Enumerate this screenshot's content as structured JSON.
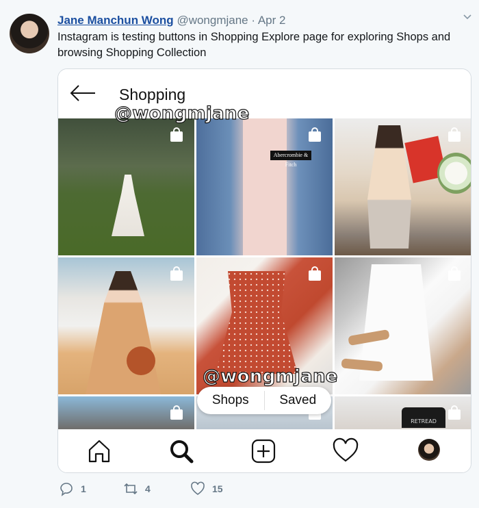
{
  "tweet": {
    "author_name": "Jane Manchun Wong",
    "handle": "@wongmjane",
    "separator": "·",
    "date": "Apr 2",
    "text": "Instagram is testing buttons in Shopping Explore page for exploring Shops and browsing Shopping Collection"
  },
  "screenshot": {
    "title": "Shopping",
    "watermark": "@wongmjane",
    "tiles": [
      {
        "name": "dress-photo"
      },
      {
        "name": "hoodie-photo",
        "label": "Abercrombie & Fitch"
      },
      {
        "name": "flowers-photo"
      },
      {
        "name": "camel-suit-photo"
      },
      {
        "name": "romper-photo"
      },
      {
        "name": "white-top-photo"
      },
      {
        "name": "bag-photo"
      },
      {
        "name": "clothing-photo"
      },
      {
        "name": "retread-photo",
        "label": "RETREAD"
      }
    ],
    "pill": {
      "shops": "Shops",
      "saved": "Saved"
    },
    "nav": [
      "home-icon",
      "search-icon",
      "add-icon",
      "heart-icon",
      "profile-avatar"
    ]
  },
  "actions": {
    "reply_count": "1",
    "retweet_count": "4",
    "like_count": "15"
  },
  "colors": {
    "link": "#1b4fa0",
    "muted": "#657786",
    "background": "#f5f8fa"
  }
}
